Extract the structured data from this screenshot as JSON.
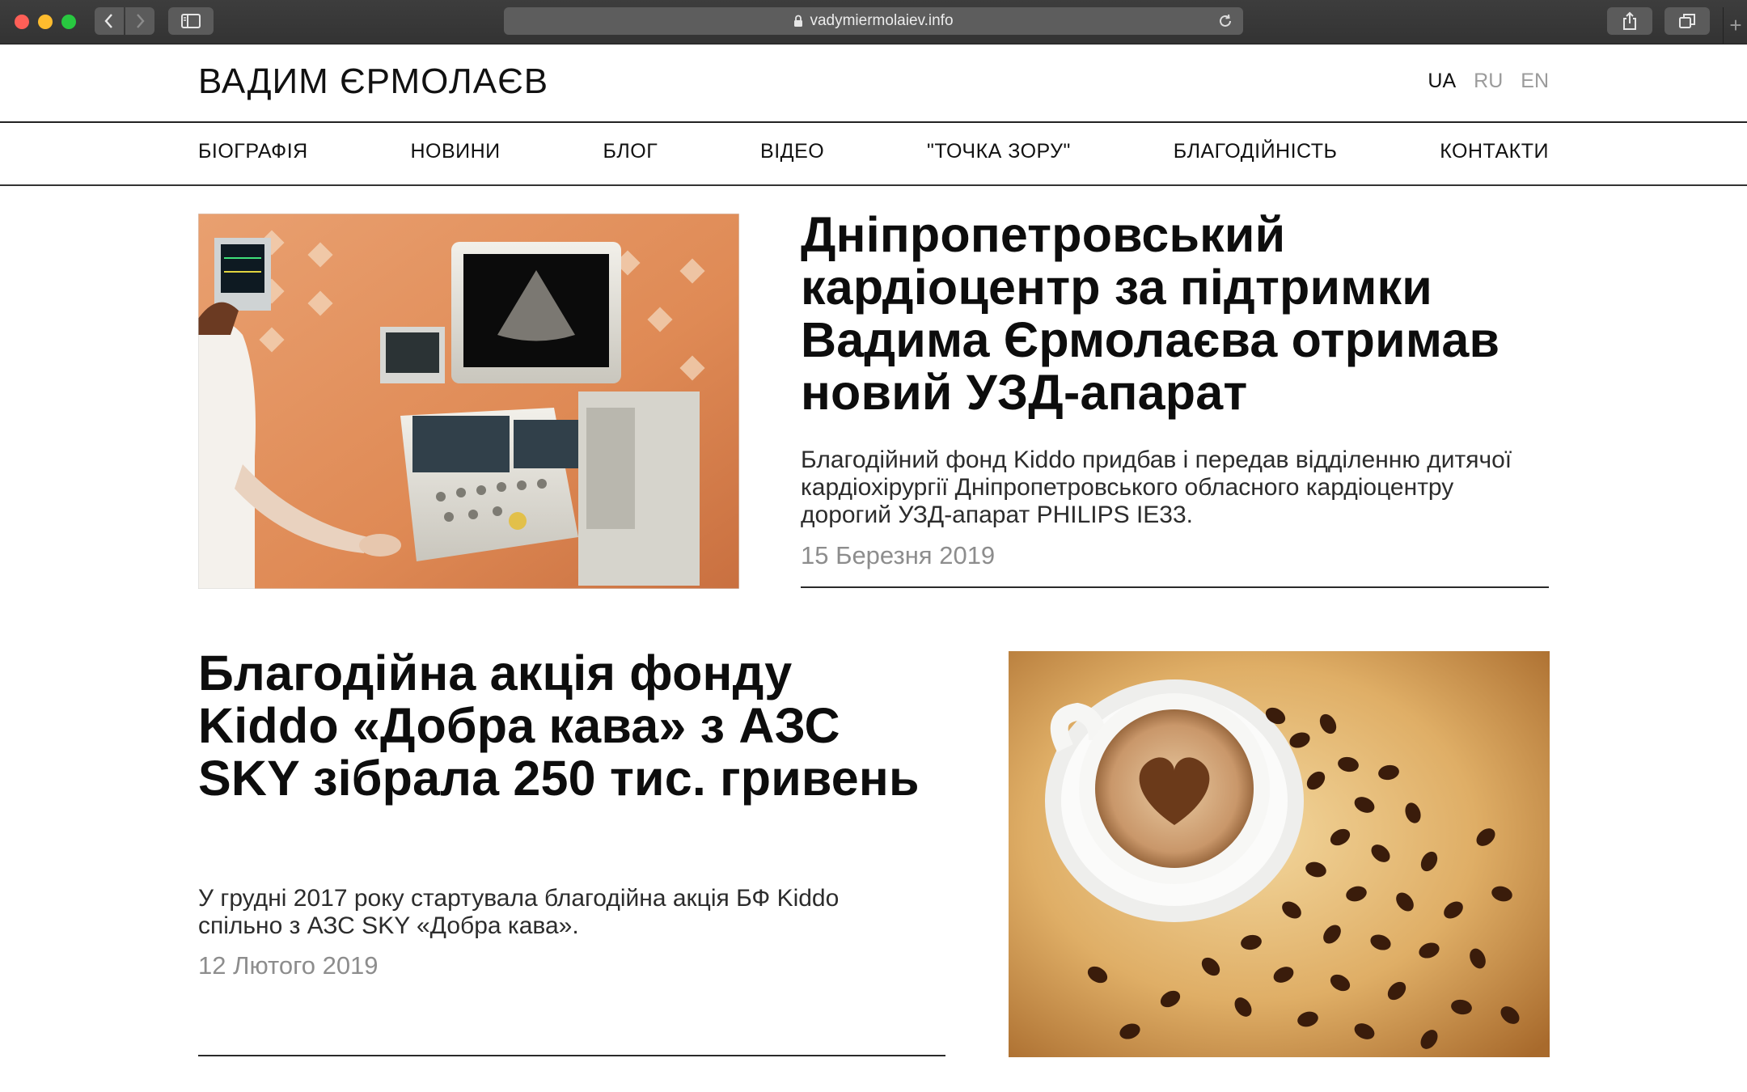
{
  "browser": {
    "url": "vadymiermolaiev.info"
  },
  "site": {
    "title": "ВАДИМ ЄРМОЛАЄВ",
    "languages": [
      {
        "label": "UA",
        "active": true
      },
      {
        "label": "RU",
        "active": false
      },
      {
        "label": "EN",
        "active": false
      }
    ]
  },
  "menu": {
    "items": [
      {
        "label": "БІОГРАФІЯ"
      },
      {
        "label": "НОВИНИ"
      },
      {
        "label": "БЛОГ"
      },
      {
        "label": "ВІДЕО"
      },
      {
        "label": "\"ТОЧКА ЗОРУ\""
      },
      {
        "label": "БЛАГОДІЙНІСТЬ"
      },
      {
        "label": "КОНТАКТИ"
      }
    ]
  },
  "articles": [
    {
      "title": "Дніпропетровський кардіоцентр за підтримки Вадима Єрмолаєва отримав новий УЗД-апарат",
      "excerpt": "Благодійний фонд Kiddo придбав і передав відділенню дитячої кардіохірургії Дніпропетровського обласного кардіоцентру дорогий УЗД-апарат PHILIPS IE33.",
      "date": "15 Березня 2019",
      "image": "ultrasound-machine-photo"
    },
    {
      "title": "Благодійна акція фонду Kiddo «Добра кава» з АЗС SKY зібрала 250 тис. гривень",
      "excerpt": "У грудні 2017 року стартувала благодійна акція БФ Kiddo спільно з АЗС SKY «Добра кава».",
      "date": "12 Лютого 2019",
      "image": "coffee-cup-heart-photo"
    }
  ]
}
